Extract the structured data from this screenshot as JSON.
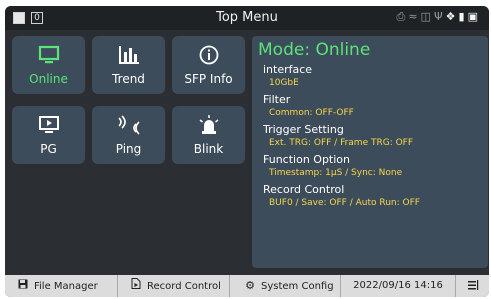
{
  "topbar": {
    "title": "Top Menu",
    "box_label": "0",
    "status_icons": [
      "printer-icon",
      "wifi-icon",
      "network-icon",
      "usb-icon",
      "tag-icon",
      "sd-card-icon",
      "battery-icon"
    ]
  },
  "tiles": [
    {
      "label": "Online",
      "icon": "monitor-icon",
      "active": true
    },
    {
      "label": "Trend",
      "icon": "bar-chart-icon",
      "active": false
    },
    {
      "label": "SFP Info",
      "icon": "info-icon",
      "active": false
    },
    {
      "label": "PG",
      "icon": "play-screen-icon",
      "active": false
    },
    {
      "label": "Ping",
      "icon": "ping-icon",
      "active": false
    },
    {
      "label": "Blink",
      "icon": "beacon-icon",
      "active": false
    }
  ],
  "panel": {
    "mode": "Mode: Online",
    "sections": [
      {
        "title": "interface",
        "value": "10GbE"
      },
      {
        "title": "Filter",
        "value": "Common: OFF-OFF"
      },
      {
        "title": "Trigger Setting",
        "value": "Ext. TRG: OFF / Frame TRG: OFF"
      },
      {
        "title": "Function Option",
        "value": "Timestamp: 1μS / Sync: None"
      },
      {
        "title": "Record Control",
        "value": "BUF0 / Save: OFF / Auto Run: OFF"
      }
    ]
  },
  "bottombar": {
    "file_manager": "File Manager",
    "record_control": "Record Control",
    "system_config": "System Config",
    "datetime": "2022/09/16  14:16"
  },
  "colors": {
    "accent_green": "#5ce27a",
    "value_yellow": "#f5d54a",
    "tile_bg": "#3d4c5a",
    "screen_bg": "#2b2f33"
  }
}
